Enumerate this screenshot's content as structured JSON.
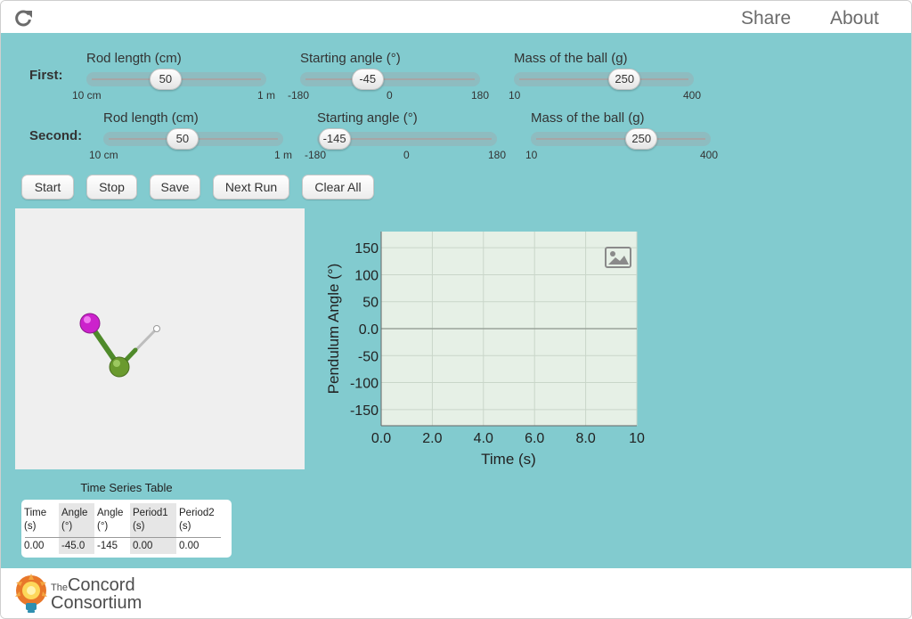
{
  "header": {
    "reload_icon": "reload-icon",
    "share_label": "Share",
    "about_label": "About"
  },
  "controls": {
    "first": {
      "label": "First:",
      "rod": {
        "label": "Rod length (cm)",
        "value": "50",
        "min_label": "10 cm",
        "max_label": "1 m",
        "fraction": 0.44
      },
      "angle": {
        "label": "Starting angle (°)",
        "value": "-45",
        "min_label": "-180",
        "mid_label": "0",
        "max_label": "180",
        "fraction": 0.375
      },
      "mass": {
        "label": "Mass of the ball (g)",
        "value": "250",
        "min_label": "10",
        "max_label": "400",
        "fraction": 0.615
      }
    },
    "second": {
      "label": "Second:",
      "rod": {
        "label": "Rod length (cm)",
        "value": "50",
        "min_label": "10 cm",
        "max_label": "1 m",
        "fraction": 0.44
      },
      "angle": {
        "label": "Starting angle (°)",
        "value": "-145",
        "min_label": "-180",
        "mid_label": "0",
        "max_label": "180",
        "fraction": 0.097
      },
      "mass": {
        "label": "Mass of the ball (g)",
        "value": "250",
        "min_label": "10",
        "max_label": "400",
        "fraction": 0.615
      }
    }
  },
  "buttons": {
    "start": "Start",
    "stop": "Stop",
    "save": "Save",
    "next_run": "Next Run",
    "clear_all": "Clear All"
  },
  "simulation": {
    "pendulum1_color": "#5b8a2e",
    "pendulum2_color": "#cc22cc"
  },
  "chart_data": {
    "type": "line",
    "xlabel": "Time (s)",
    "ylabel": "Pendulum Angle (°)",
    "xlim": [
      0,
      10
    ],
    "ylim": [
      -180,
      180
    ],
    "xticks": [
      "0.0",
      "2.0",
      "4.0",
      "6.0",
      "8.0",
      "10"
    ],
    "yticks": [
      "150",
      "100",
      "50",
      "0.0",
      "-50",
      "-100",
      "-150"
    ],
    "grid": true,
    "series": [],
    "snapshot_icon": "image-icon",
    "plot_bg": "#e6f0e6"
  },
  "table": {
    "title": "Time Series Table",
    "columns": [
      {
        "header": "Time\n(s)",
        "value": "0.00"
      },
      {
        "header": "Angle\n(°)",
        "value": "-45.0"
      },
      {
        "header": "Angle\n(°)",
        "value": "-145"
      },
      {
        "header": "Period1\n(s)",
        "value": "0.00"
      },
      {
        "header": "Period2\n(s)",
        "value": "0.00"
      }
    ]
  },
  "footer": {
    "logo_the": "The",
    "logo_line1": "Concord",
    "logo_line2": "Consortium"
  }
}
